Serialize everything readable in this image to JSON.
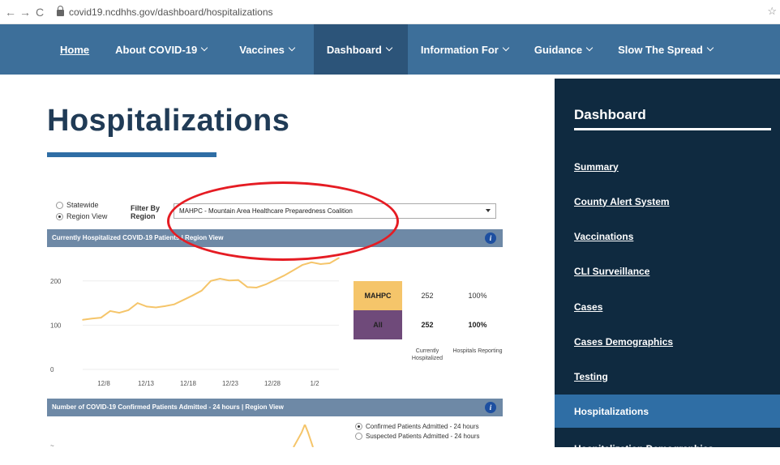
{
  "browser": {
    "url": "covid19.ncdhhs.gov/dashboard/hospitalizations"
  },
  "topnav": {
    "home": "Home",
    "about": "About COVID-19",
    "vaccines": "Vaccines",
    "dashboard": "Dashboard",
    "info": "Information For",
    "guidance": "Guidance",
    "slow": "Slow The Spread"
  },
  "page": {
    "title": "Hospitalizations"
  },
  "filter": {
    "statewide": "Statewide",
    "region_view": "Region View",
    "filter_by_1": "Filter By",
    "filter_by_2": "Region",
    "selected": "MAHPC - Mountain Area Healthcare Preparedness Coalition"
  },
  "panel1": {
    "title": "Currently Hospitalized COVID-19 Patients | Region View"
  },
  "panel2": {
    "title": "Number of COVID-19 Confirmed Patients Admitted - 24 hours | Region View"
  },
  "stats": {
    "region_label": "MAHPC",
    "region_value": "252",
    "region_pct": "100%",
    "all_label": "All",
    "all_value": "252",
    "all_pct": "100%",
    "col1": "Currently Hospitalized",
    "col2": "Hospitals Reporting",
    "region_color": "#f5c56a",
    "all_color": "#6f4a7a"
  },
  "legend2": {
    "confirmed": "Confirmed Patients Admitted - 24 hours",
    "suspected": "Suspected Patients Admitted - 24 hours"
  },
  "sidebar": {
    "title": "Dashboard",
    "items": [
      "Summary",
      "County Alert System",
      "Vaccinations",
      "CLI Surveillance",
      "Cases",
      "Cases Demographics",
      "Testing",
      "Hospitalizations",
      "Hospitalization Demographics"
    ]
  },
  "chart_data": {
    "type": "line",
    "ylim": [
      0,
      260
    ],
    "yticks": [
      "0",
      "100",
      "200"
    ],
    "xticks": [
      "12/8",
      "12/13",
      "12/18",
      "12/23",
      "12/28",
      "1/2"
    ],
    "color": "#f5c56a",
    "series": [
      {
        "values": [
          112,
          115,
          117,
          132,
          128,
          134,
          150,
          142,
          140,
          143,
          147,
          157,
          167,
          178,
          200,
          205,
          201,
          202,
          186,
          185,
          192,
          202,
          212,
          224,
          236,
          242,
          238,
          240,
          252
        ]
      }
    ]
  }
}
